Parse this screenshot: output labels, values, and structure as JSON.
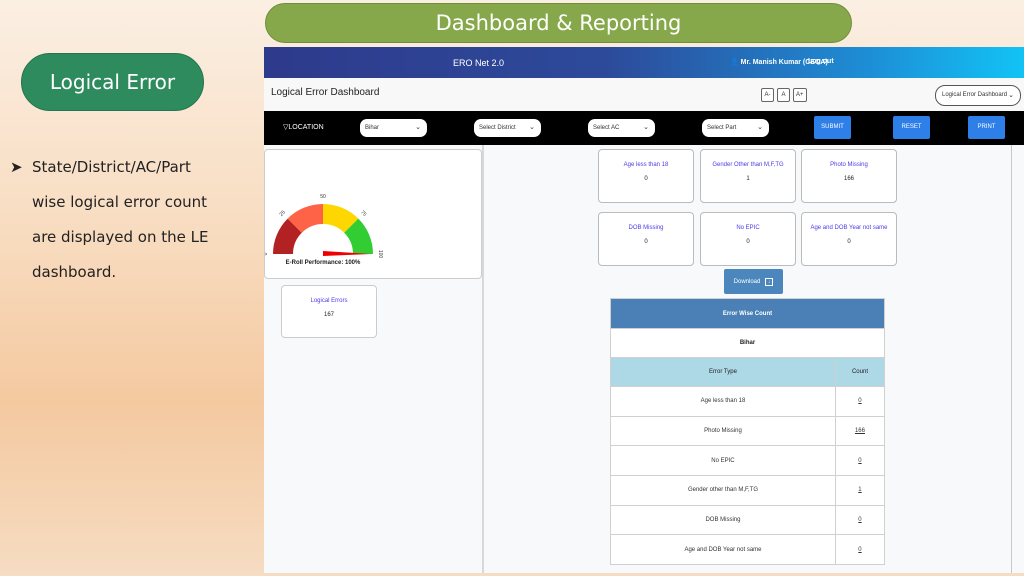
{
  "slide": {
    "title": "Dashboard & Reporting",
    "section_label": "Logical Error",
    "bullet_icon": "arrow-bullet-icon",
    "bullet_lines": [
      "State/District/AC/Part",
      "wise logical error count",
      "are displayed on the LE",
      "dashboard."
    ]
  },
  "app": {
    "brand": "ERO Net 2.0",
    "user": "Mr. Manish Kumar (CEOA)",
    "logout": "Log out",
    "page_title": "Logical Error Dashboard",
    "font_buttons": [
      "A-",
      "A",
      "A+"
    ],
    "dashboard_select": "Logical Error Dashboard",
    "filters": {
      "location_label": "LOCATION",
      "state": "Bihar",
      "district": "Select District",
      "ac": "Select AC",
      "part": "Select Part",
      "submit": "SUBMIT",
      "reset": "RESET",
      "print": "PRINT"
    },
    "gauge": {
      "ticks": [
        "0",
        "25",
        "50",
        "75",
        "100"
      ],
      "value_percent": 100,
      "label": "E-Roll Performance: 100%",
      "colors": [
        "#b22222",
        "#ff6347",
        "#ffd700",
        "#32cd32"
      ]
    },
    "logical_errors": {
      "title": "Logical Errors",
      "value": "167"
    },
    "metric_cards": [
      {
        "title": "Age less than 18",
        "value": "0"
      },
      {
        "title": "Gender Other than M,F,TG",
        "value": "1"
      },
      {
        "title": "Photo Missing",
        "value": "166"
      },
      {
        "title": "DOB Missing",
        "value": "0"
      },
      {
        "title": "No EPIC",
        "value": "0"
      },
      {
        "title": "Age and DOB Year not same",
        "value": "0"
      }
    ],
    "download_label": "Download",
    "table": {
      "title": "Error Wise Count",
      "state": "Bihar",
      "columns": [
        "Error Type",
        "Count"
      ],
      "rows": [
        {
          "type": "Age less than 18",
          "count": "0"
        },
        {
          "type": "Photo Missing",
          "count": "166"
        },
        {
          "type": "No EPIC",
          "count": "0"
        },
        {
          "type": "Gender other than M,F,TG",
          "count": "1"
        },
        {
          "type": "DOB Missing",
          "count": "0"
        },
        {
          "type": "Age and DOB Year not same",
          "count": "0"
        }
      ]
    }
  }
}
